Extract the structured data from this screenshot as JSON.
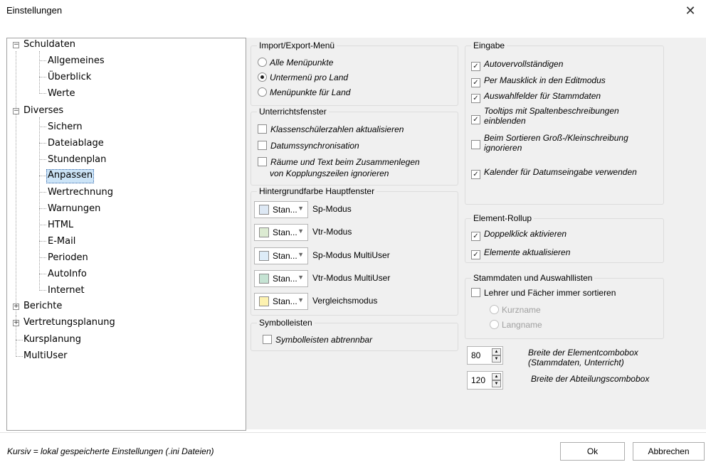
{
  "window": {
    "title": "Einstellungen",
    "close": "✕"
  },
  "tree": {
    "schuldaten": "Schuldaten",
    "allgemeines": "Allgemeines",
    "ueberblick": "Überblick",
    "werte": "Werte",
    "diverses": "Diverses",
    "sichern": "Sichern",
    "dateiablage": "Dateiablage",
    "stundenplan": "Stundenplan",
    "anpassen": "Anpassen",
    "wertrechnung": "Wertrechnung",
    "warnungen": "Warnungen",
    "html": "HTML",
    "email": "E-Mail",
    "perioden": "Perioden",
    "autoinfo": "AutoInfo",
    "internet": "Internet",
    "berichte": "Berichte",
    "vertretungsplanung": "Vertretungsplanung",
    "kursplanung": "Kursplanung",
    "multiuser": "MultiUser",
    "collapse_sign": "−",
    "expand_sign": "+"
  },
  "import_export": {
    "title": "Import/Export-Menü",
    "options": [
      "Alle Menüpunkte",
      "Untermenü pro Land",
      "Menüpunkte für Land"
    ],
    "selected_index": 1
  },
  "unterricht": {
    "title": "Unterrichtsfenster",
    "klassen": "Klassenschülerzahlen aktualisieren",
    "datum": "Datumssynchronisation",
    "raeume_line1": "Räume und Text beim Zusammenlegen",
    "raeume_line2": "von Kopplungszeilen ignorieren",
    "checked": [
      false,
      false,
      false
    ]
  },
  "hintergrund": {
    "title": "Hintergrundfarbe Hauptfenster",
    "combo_text": "Stan...",
    "arrow": "▼",
    "rows": [
      {
        "label": "Sp-Modus",
        "color": "#dde8f4"
      },
      {
        "label": "Vtr-Modus",
        "color": "#dcebd2"
      },
      {
        "label": "Sp-Modus MultiUser",
        "color": "#ddecf8"
      },
      {
        "label": "Vtr-Modus MultiUser",
        "color": "#c5e3d3"
      },
      {
        "label": "Vergleichsmodus",
        "color": "#fdf2b0"
      }
    ]
  },
  "symbolleisten": {
    "title": "Symbolleisten",
    "abtrennbar": "Symbolleisten abtrennbar",
    "checked": false
  },
  "eingabe": {
    "title": "Eingabe",
    "auto": "Autovervollständigen",
    "maus": "Per Mausklick in den Editmodus",
    "auswahl": "Auswahlfelder für Stammdaten",
    "tooltips_line1": "Tooltips mit Spaltenbeschreibungen",
    "tooltips_line2": "einblenden",
    "sort_line1": "Beim Sortieren Groß-/Kleinschreibung",
    "sort_line2": "ignorieren",
    "kalender": "Kalender für Datumseingabe verwenden",
    "checkmark": "✓",
    "checked": [
      true,
      true,
      true,
      true,
      false,
      true
    ]
  },
  "rollup": {
    "title": "Element-Rollup",
    "doppel": "Doppelklick aktivieren",
    "elemente": "Elemente aktualisieren",
    "checked": [
      true,
      true
    ]
  },
  "stammdaten": {
    "title": "Stammdaten und Auswahllisten",
    "lehrer": "Lehrer und Fächer immer sortieren",
    "kurzname": "Kurzname",
    "langname": "Langname",
    "checked": false
  },
  "spinners": {
    "element_value": "80",
    "element_label_line1": "Breite der Elementcombobox",
    "element_label_line2": "(Stammdaten, Unterricht)",
    "abteilung_value": "120",
    "abteilung_label": "Breite der Abteilungscombobox",
    "up": "▲",
    "down": "▼"
  },
  "footer": {
    "note": "Kursiv = lokal gespeicherte Einstellungen (.ini Dateien)",
    "ok": "Ok",
    "cancel": "Abbrechen"
  }
}
